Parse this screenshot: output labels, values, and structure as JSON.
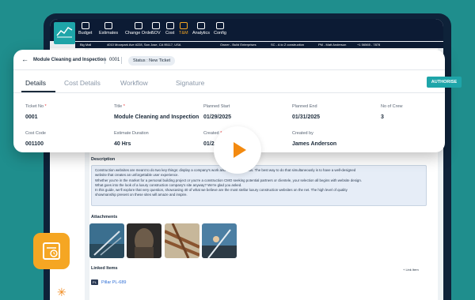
{
  "nav": {
    "items": [
      {
        "label": "Budget",
        "icon": "budget-icon"
      },
      {
        "label": "Estimates",
        "icon": "estimates-icon"
      },
      {
        "label": "Change Order",
        "icon": "change-order-icon"
      },
      {
        "label": "SOV",
        "icon": "sov-icon"
      },
      {
        "label": "Cost",
        "icon": "cost-icon"
      },
      {
        "label": "T&M",
        "icon": "tm-icon",
        "active": true
      },
      {
        "label": "Analytics",
        "icon": "analytics-icon"
      },
      {
        "label": "Config",
        "icon": "config-icon"
      }
    ]
  },
  "subbar": {
    "project": "Big Mall",
    "address": "4010 Moorpark Ave #228, San Jose, CA 95117, USA",
    "owner": "Owner - Build Enterprises",
    "sc": "SC - A to Z construction",
    "pm": "PM - Matt Anderson",
    "phone": "+1 56565 - 7878"
  },
  "ticket": {
    "title": "Module Cleaning and Inspection",
    "number": "0001",
    "status": "Status : New Ticket"
  },
  "tabs": [
    "Details",
    "Cost Details",
    "Workflow",
    "Signature"
  ],
  "authorise_label": "AUTHORISE",
  "fields": {
    "ticket_no": {
      "label": "Ticket No",
      "value": "0001"
    },
    "title": {
      "label": "Title",
      "value": "Module Cleaning and Inspection"
    },
    "planned_start": {
      "label": "Planned Start",
      "value": "01/29/2025"
    },
    "planned_end": {
      "label": "Planned End",
      "value": "01/31/2025"
    },
    "no_of_crew": {
      "label": "No of Crew",
      "value": "3"
    },
    "cost_code": {
      "label": "Cost Code",
      "value": "001100"
    },
    "estimate_duration": {
      "label": "Estimate Duration",
      "value": "40 Hrs"
    },
    "created": {
      "label": "Created",
      "value": "01/2"
    },
    "created_by": {
      "label": "Created by",
      "value": "James Anderson"
    }
  },
  "description": {
    "heading": "Description",
    "lines": [
      "Construction websites are meant to do two key things: display a company's work and attract new leads. The best way to do that simultaneously is to have a well-designed",
      "website that creates an unforgettable user experience.",
      "Whether you're in the market for a personal building project or you're a construction CMO seeking potential partners or clientele, your selection all begins with website design.",
      "What goes into the look of a luxury construction company's site anyway? We're glad you asked.",
      "In this guide, we'll explore that very question, showcasing 40 of what we believe are the most stellar luxury construction websites on the net. The high level of quality",
      "showmanship present on these sites will amaze and inspire."
    ]
  },
  "attachments": {
    "heading": "Attachments",
    "images": [
      "attachment-photo-1",
      "attachment-photo-2",
      "attachment-photo-3",
      "attachment-photo-4"
    ]
  },
  "linked_items": {
    "heading": "Linked Items",
    "add_label": "+ Link Item",
    "items": [
      {
        "tag": "PL",
        "label": "Pillar PL-689"
      }
    ]
  },
  "colors": {
    "accent": "#1ea5a9",
    "nav_bg": "#0c1b34",
    "active_nav": "#f5a623",
    "play": "#f38a10",
    "link": "#2f6fd6"
  }
}
